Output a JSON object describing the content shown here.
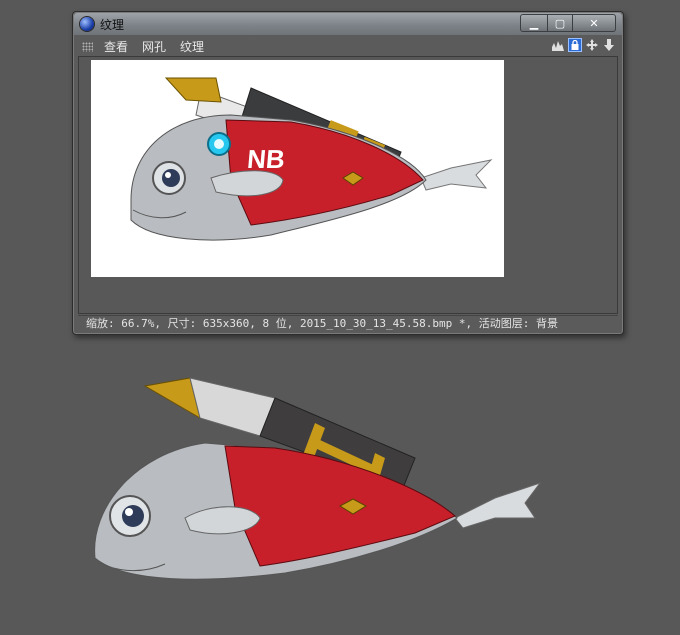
{
  "window": {
    "title": "纹理",
    "buttons": {
      "minimize": "▁",
      "maximize": "▢",
      "close": "✕"
    }
  },
  "menu": {
    "items": [
      "查看",
      "网孔",
      "纹理"
    ]
  },
  "toolbar_icons": [
    "histogram-icon",
    "lock-icon",
    "move-icon",
    "down-arrow-icon"
  ],
  "texture_image": {
    "label": "NB"
  },
  "status": {
    "text": "缩放: 66.7%, 尺寸: 635x360, 8 位, 2015_10_30_13_45.58.bmp *, 活动图层: 背景"
  },
  "colors": {
    "background": "#585858",
    "red_body": "#c8202b",
    "silver": "#b9bcc0",
    "gold": "#c79a1a",
    "eye_glow": "#26c8f0"
  }
}
